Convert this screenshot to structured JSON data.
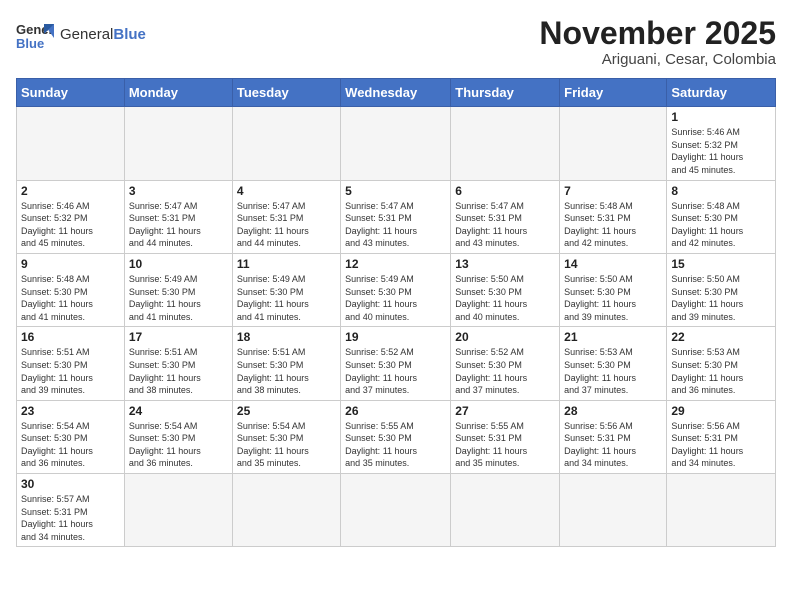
{
  "header": {
    "logo_general": "General",
    "logo_blue": "Blue",
    "month_title": "November 2025",
    "subtitle": "Ariguani, Cesar, Colombia"
  },
  "weekdays": [
    "Sunday",
    "Monday",
    "Tuesday",
    "Wednesday",
    "Thursday",
    "Friday",
    "Saturday"
  ],
  "weeks": [
    [
      {
        "day": "",
        "info": ""
      },
      {
        "day": "",
        "info": ""
      },
      {
        "day": "",
        "info": ""
      },
      {
        "day": "",
        "info": ""
      },
      {
        "day": "",
        "info": ""
      },
      {
        "day": "",
        "info": ""
      },
      {
        "day": "1",
        "info": "Sunrise: 5:46 AM\nSunset: 5:32 PM\nDaylight: 11 hours\nand 45 minutes."
      }
    ],
    [
      {
        "day": "2",
        "info": "Sunrise: 5:46 AM\nSunset: 5:32 PM\nDaylight: 11 hours\nand 45 minutes."
      },
      {
        "day": "3",
        "info": "Sunrise: 5:47 AM\nSunset: 5:31 PM\nDaylight: 11 hours\nand 44 minutes."
      },
      {
        "day": "4",
        "info": "Sunrise: 5:47 AM\nSunset: 5:31 PM\nDaylight: 11 hours\nand 44 minutes."
      },
      {
        "day": "5",
        "info": "Sunrise: 5:47 AM\nSunset: 5:31 PM\nDaylight: 11 hours\nand 43 minutes."
      },
      {
        "day": "6",
        "info": "Sunrise: 5:47 AM\nSunset: 5:31 PM\nDaylight: 11 hours\nand 43 minutes."
      },
      {
        "day": "7",
        "info": "Sunrise: 5:48 AM\nSunset: 5:31 PM\nDaylight: 11 hours\nand 42 minutes."
      },
      {
        "day": "8",
        "info": "Sunrise: 5:48 AM\nSunset: 5:30 PM\nDaylight: 11 hours\nand 42 minutes."
      }
    ],
    [
      {
        "day": "9",
        "info": "Sunrise: 5:48 AM\nSunset: 5:30 PM\nDaylight: 11 hours\nand 41 minutes."
      },
      {
        "day": "10",
        "info": "Sunrise: 5:49 AM\nSunset: 5:30 PM\nDaylight: 11 hours\nand 41 minutes."
      },
      {
        "day": "11",
        "info": "Sunrise: 5:49 AM\nSunset: 5:30 PM\nDaylight: 11 hours\nand 41 minutes."
      },
      {
        "day": "12",
        "info": "Sunrise: 5:49 AM\nSunset: 5:30 PM\nDaylight: 11 hours\nand 40 minutes."
      },
      {
        "day": "13",
        "info": "Sunrise: 5:50 AM\nSunset: 5:30 PM\nDaylight: 11 hours\nand 40 minutes."
      },
      {
        "day": "14",
        "info": "Sunrise: 5:50 AM\nSunset: 5:30 PM\nDaylight: 11 hours\nand 39 minutes."
      },
      {
        "day": "15",
        "info": "Sunrise: 5:50 AM\nSunset: 5:30 PM\nDaylight: 11 hours\nand 39 minutes."
      }
    ],
    [
      {
        "day": "16",
        "info": "Sunrise: 5:51 AM\nSunset: 5:30 PM\nDaylight: 11 hours\nand 39 minutes."
      },
      {
        "day": "17",
        "info": "Sunrise: 5:51 AM\nSunset: 5:30 PM\nDaylight: 11 hours\nand 38 minutes."
      },
      {
        "day": "18",
        "info": "Sunrise: 5:51 AM\nSunset: 5:30 PM\nDaylight: 11 hours\nand 38 minutes."
      },
      {
        "day": "19",
        "info": "Sunrise: 5:52 AM\nSunset: 5:30 PM\nDaylight: 11 hours\nand 37 minutes."
      },
      {
        "day": "20",
        "info": "Sunrise: 5:52 AM\nSunset: 5:30 PM\nDaylight: 11 hours\nand 37 minutes."
      },
      {
        "day": "21",
        "info": "Sunrise: 5:53 AM\nSunset: 5:30 PM\nDaylight: 11 hours\nand 37 minutes."
      },
      {
        "day": "22",
        "info": "Sunrise: 5:53 AM\nSunset: 5:30 PM\nDaylight: 11 hours\nand 36 minutes."
      }
    ],
    [
      {
        "day": "23",
        "info": "Sunrise: 5:54 AM\nSunset: 5:30 PM\nDaylight: 11 hours\nand 36 minutes."
      },
      {
        "day": "24",
        "info": "Sunrise: 5:54 AM\nSunset: 5:30 PM\nDaylight: 11 hours\nand 36 minutes."
      },
      {
        "day": "25",
        "info": "Sunrise: 5:54 AM\nSunset: 5:30 PM\nDaylight: 11 hours\nand 35 minutes."
      },
      {
        "day": "26",
        "info": "Sunrise: 5:55 AM\nSunset: 5:30 PM\nDaylight: 11 hours\nand 35 minutes."
      },
      {
        "day": "27",
        "info": "Sunrise: 5:55 AM\nSunset: 5:31 PM\nDaylight: 11 hours\nand 35 minutes."
      },
      {
        "day": "28",
        "info": "Sunrise: 5:56 AM\nSunset: 5:31 PM\nDaylight: 11 hours\nand 34 minutes."
      },
      {
        "day": "29",
        "info": "Sunrise: 5:56 AM\nSunset: 5:31 PM\nDaylight: 11 hours\nand 34 minutes."
      }
    ],
    [
      {
        "day": "30",
        "info": "Sunrise: 5:57 AM\nSunset: 5:31 PM\nDaylight: 11 hours\nand 34 minutes."
      },
      {
        "day": "",
        "info": ""
      },
      {
        "day": "",
        "info": ""
      },
      {
        "day": "",
        "info": ""
      },
      {
        "day": "",
        "info": ""
      },
      {
        "day": "",
        "info": ""
      },
      {
        "day": "",
        "info": ""
      }
    ]
  ]
}
